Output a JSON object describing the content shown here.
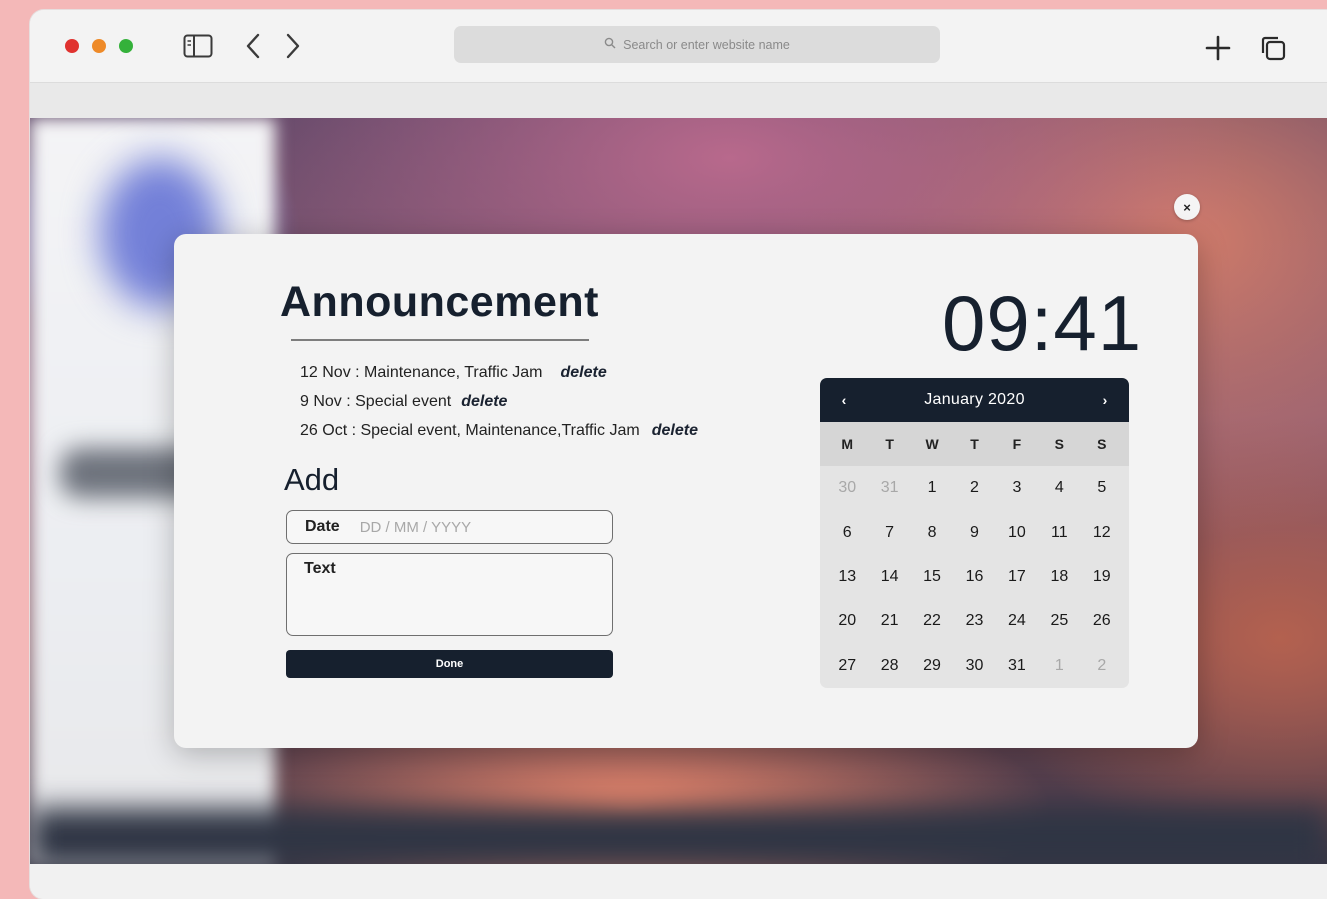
{
  "browser": {
    "address_placeholder": "Search or enter website name",
    "controls": [
      "close",
      "minimize",
      "zoom"
    ],
    "traffic_light_colors": {
      "close": "#e0322f",
      "minimize": "#ee8a28",
      "zoom": "#34b13a"
    }
  },
  "announcement": {
    "title": "Announcement",
    "items": [
      {
        "text": "12 Nov : Maintenance, Traffic Jam",
        "delete_label": "delete"
      },
      {
        "text": "9 Nov : Special event",
        "delete_label": "delete"
      },
      {
        "text": "26 Oct : Special event, Maintenance,Traffic Jam",
        "delete_label": "delete"
      }
    ]
  },
  "add_form": {
    "title": "Add",
    "date_label": "Date",
    "date_placeholder": "DD / MM / YYYY",
    "text_label": "Text",
    "done_label": "Done"
  },
  "clock": {
    "time": "09:41"
  },
  "calendar": {
    "month_label": "January 2020",
    "prev_icon": "‹",
    "next_icon": "›",
    "weekdays": [
      "M",
      "T",
      "W",
      "T",
      "F",
      "S",
      "S"
    ],
    "days": [
      {
        "d": "30",
        "muted": true
      },
      {
        "d": "31",
        "muted": true
      },
      {
        "d": "1"
      },
      {
        "d": "2"
      },
      {
        "d": "3"
      },
      {
        "d": "4"
      },
      {
        "d": "5"
      },
      {
        "d": "6"
      },
      {
        "d": "7"
      },
      {
        "d": "8"
      },
      {
        "d": "9"
      },
      {
        "d": "10"
      },
      {
        "d": "11"
      },
      {
        "d": "12"
      },
      {
        "d": "13"
      },
      {
        "d": "14"
      },
      {
        "d": "15"
      },
      {
        "d": "16"
      },
      {
        "d": "17"
      },
      {
        "d": "18"
      },
      {
        "d": "19"
      },
      {
        "d": "20"
      },
      {
        "d": "21"
      },
      {
        "d": "22"
      },
      {
        "d": "23"
      },
      {
        "d": "24"
      },
      {
        "d": "25"
      },
      {
        "d": "26"
      },
      {
        "d": "27"
      },
      {
        "d": "28"
      },
      {
        "d": "29"
      },
      {
        "d": "30"
      },
      {
        "d": "31"
      },
      {
        "d": "1",
        "muted": true
      },
      {
        "d": "2",
        "muted": true
      }
    ]
  },
  "modal": {
    "close_icon": "×"
  },
  "colors": {
    "accent": "#16202e",
    "page_background": "#f4b8b8"
  }
}
